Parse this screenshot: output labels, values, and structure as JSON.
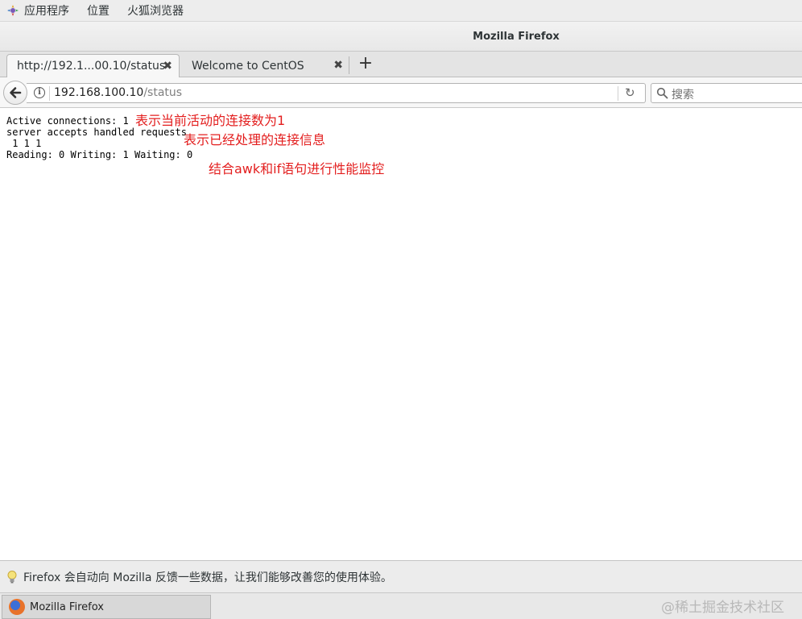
{
  "topbar": {
    "applications": "应用程序",
    "places": "位置",
    "firefox": "火狐浏览器"
  },
  "window": {
    "title": "Mozilla Firefox"
  },
  "tabs": [
    {
      "label": "http://192.1...00.10/status",
      "active": true
    },
    {
      "label": "Welcome to CentOS",
      "active": false
    }
  ],
  "navbar": {
    "url_host": "192.168.100.10",
    "url_path": "/status",
    "search_placeholder": "搜索"
  },
  "status": {
    "line1": "Active connections: 1",
    "line2": "server accepts handled requests",
    "line3": " 1 1 1",
    "line4": "Reading: 0 Writing: 1 Waiting: 0"
  },
  "annotations": {
    "a1": "表示当前活动的连接数为1",
    "a2": "表示已经处理的连接信息",
    "a3": "结合awk和if语句进行性能监控"
  },
  "notification": {
    "text": "Firefox 会自动向 Mozilla 反馈一些数据，让我们能够改善您的使用体验。"
  },
  "taskbar": {
    "item_label": "Mozilla Firefox",
    "watermark": "@稀土掘金技术社区"
  },
  "colors": {
    "annotation": "#e31e1e"
  }
}
